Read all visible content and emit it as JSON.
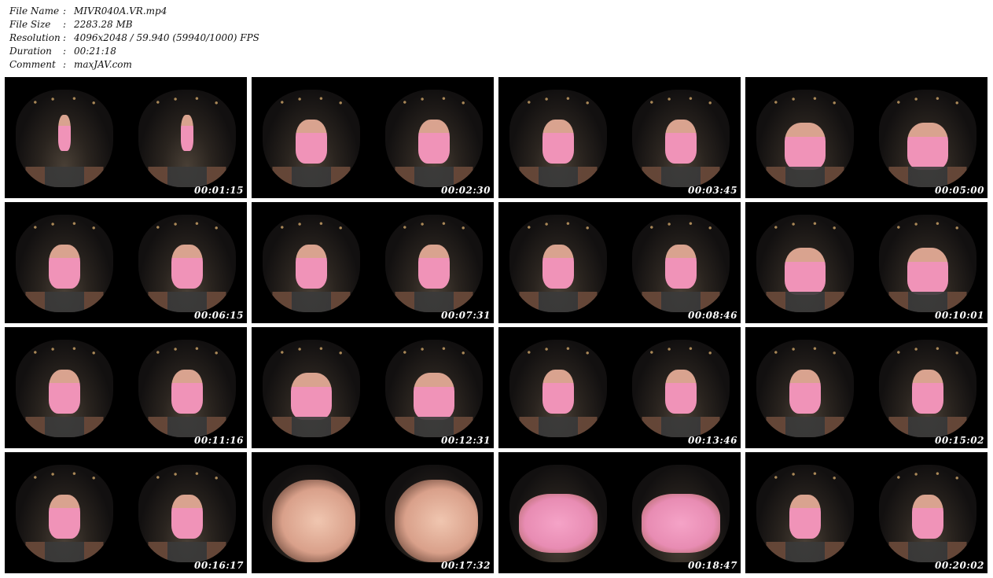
{
  "info": {
    "rows": [
      {
        "label": "File Name",
        "sep": ":",
        "value": "MIVR040A.VR.mp4"
      },
      {
        "label": "File Size",
        "sep": ":",
        "value": "2283.28 MB"
      },
      {
        "label": "Resolution",
        "sep": ":",
        "value": "4096x2048 / 59.940 (59940/1000) FPS"
      },
      {
        "label": "Duration",
        "sep": ":",
        "value": "00:21:18"
      },
      {
        "label": "Comment",
        "sep": ":",
        "value": "maxJAV.com"
      }
    ]
  },
  "thumbnails": [
    {
      "time": "00:01:15",
      "scene": "standing-far"
    },
    {
      "time": "00:02:30",
      "scene": "kneel-mid"
    },
    {
      "time": "00:03:45",
      "scene": "kneel-mid"
    },
    {
      "time": "00:05:00",
      "scene": "lean-close"
    },
    {
      "time": "00:06:15",
      "scene": "kneel-mid"
    },
    {
      "time": "00:07:31",
      "scene": "kneel-mid"
    },
    {
      "time": "00:08:46",
      "scene": "kneel-mid"
    },
    {
      "time": "00:10:01",
      "scene": "lean-close"
    },
    {
      "time": "00:11:16",
      "scene": "kneel-mid"
    },
    {
      "time": "00:12:31",
      "scene": "lean-close"
    },
    {
      "time": "00:13:46",
      "scene": "kneel-mid"
    },
    {
      "time": "00:15:02",
      "scene": "kneel-mid"
    },
    {
      "time": "00:16:17",
      "scene": "kneel-mid"
    },
    {
      "time": "00:17:32",
      "scene": "face-close"
    },
    {
      "time": "00:18:47",
      "scene": "pink-close"
    },
    {
      "time": "00:20:02",
      "scene": "kneel-mid"
    }
  ]
}
